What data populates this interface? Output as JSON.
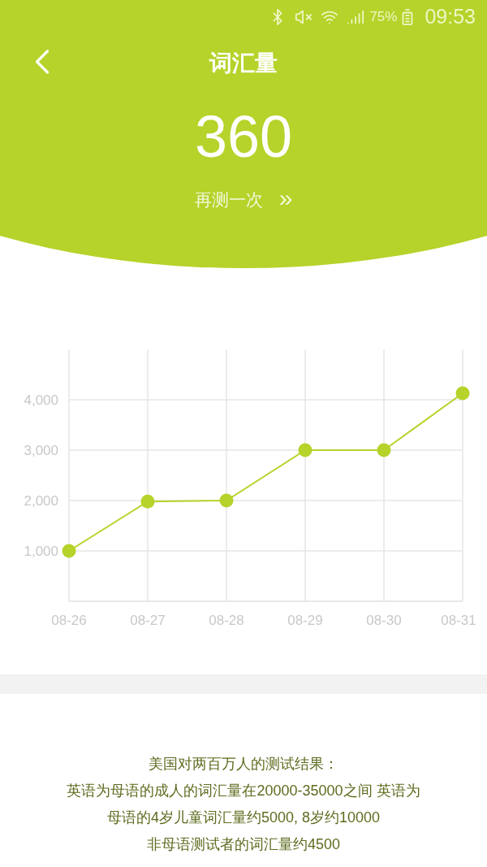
{
  "status_bar": {
    "battery": "75%",
    "time": "09:53"
  },
  "header": {
    "title": "词汇量",
    "score": "360",
    "retest": {
      "label": "再测一次",
      "arrow": "»"
    }
  },
  "chart_data": {
    "type": "line",
    "grid": true,
    "categories": [
      "08-26",
      "08-27",
      "08-28",
      "08-29",
      "08-30",
      "08-31"
    ],
    "ylim": [
      0,
      5000
    ],
    "yticks": [
      {
        "value": 1000,
        "label": "1,000"
      },
      {
        "value": 2000,
        "label": "2,000"
      },
      {
        "value": 3000,
        "label": "3,000"
      },
      {
        "value": 4000,
        "label": "4,000"
      }
    ],
    "series": [
      {
        "marker": true,
        "color": "#b5d32a",
        "values": [
          1000,
          1980,
          2000,
          3000,
          3000,
          4130
        ]
      }
    ]
  },
  "note": {
    "lines": [
      "美国对两百万人的测试结果：",
      "英语为母语的成人的词汇量在20000-35000之间 英语为母语的4岁儿童词汇量约5000, 8岁约10000",
      "非母语测试者的词汇量约4500"
    ]
  }
}
